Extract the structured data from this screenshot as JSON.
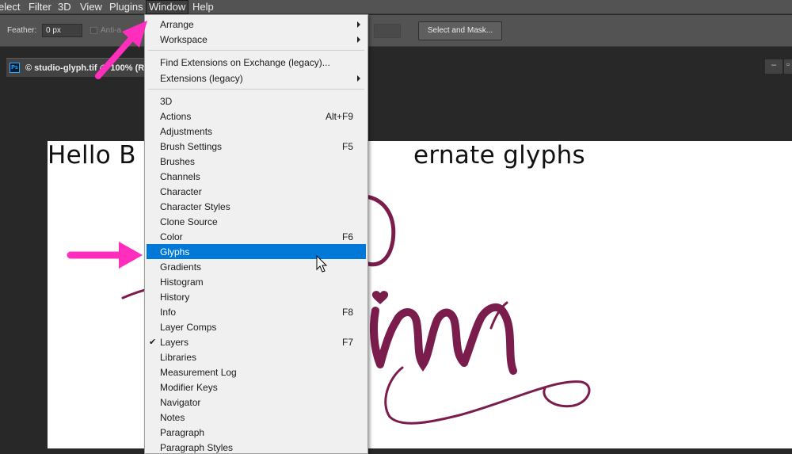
{
  "menubar": {
    "items": [
      "elect",
      "Filter",
      "3D",
      "View",
      "Plugins",
      "Window",
      "Help"
    ],
    "active_index": 5
  },
  "options_bar": {
    "feather_label": "Feather:",
    "feather_value": "0 px",
    "antialias_label": "Anti-a",
    "select_mask_label": "Select and Mask..."
  },
  "document": {
    "tab_icon": "Ps",
    "tab_title": "© studio-glyph.tif @ 100% (R"
  },
  "canvas": {
    "headline_left": "Hello B",
    "headline_right": "ernate glyphs",
    "art_color": "#7a1d4c"
  },
  "window_menu": {
    "items": [
      {
        "label": "Arrange",
        "submenu": true
      },
      {
        "label": "Workspace",
        "submenu": true
      },
      {
        "label": "Find Extensions on Exchange (legacy)...",
        "separator_before": true
      },
      {
        "label": "Extensions (legacy)",
        "submenu": true
      },
      {
        "label": "3D",
        "separator_before": true
      },
      {
        "label": "Actions",
        "shortcut": "Alt+F9"
      },
      {
        "label": "Adjustments"
      },
      {
        "label": "Brush Settings",
        "shortcut": "F5"
      },
      {
        "label": "Brushes"
      },
      {
        "label": "Channels"
      },
      {
        "label": "Character"
      },
      {
        "label": "Character Styles"
      },
      {
        "label": "Clone Source"
      },
      {
        "label": "Color",
        "shortcut": "F6"
      },
      {
        "label": "Glyphs",
        "highlighted": true
      },
      {
        "label": "Gradients"
      },
      {
        "label": "Histogram"
      },
      {
        "label": "History"
      },
      {
        "label": "Info",
        "shortcut": "F8"
      },
      {
        "label": "Layer Comps"
      },
      {
        "label": "Layers",
        "shortcut": "F7",
        "checked": true
      },
      {
        "label": "Libraries"
      },
      {
        "label": "Measurement Log"
      },
      {
        "label": "Modifier Keys"
      },
      {
        "label": "Navigator"
      },
      {
        "label": "Notes"
      },
      {
        "label": "Paragraph"
      },
      {
        "label": "Paragraph Styles"
      }
    ]
  },
  "annotation_color": "#ff2ebd",
  "highlight_color": "#0078d7"
}
